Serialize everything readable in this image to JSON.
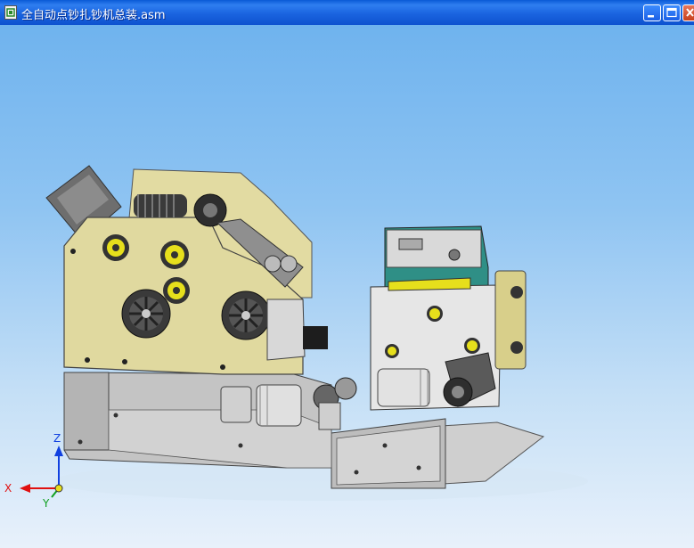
{
  "window": {
    "title": "全自动点钞扎钞机总装.asm",
    "icon": "assembly-document-icon",
    "controls": [
      "minimize-icon",
      "maximize-icon",
      "close-icon"
    ]
  },
  "triad": {
    "x_label": "X",
    "y_label": "Y",
    "z_label": "Z",
    "x_color": "#e01010",
    "y_color": "#10a020",
    "z_color": "#1040e0"
  },
  "colors": {
    "titlebar": "#1a64e0",
    "housing": "#e0d9a0",
    "base_plate": "#c8c8c8",
    "frame_green": "#2f8f86",
    "wheel_yellow": "#e8e020",
    "wheel_dark": "#3a3a3a"
  }
}
